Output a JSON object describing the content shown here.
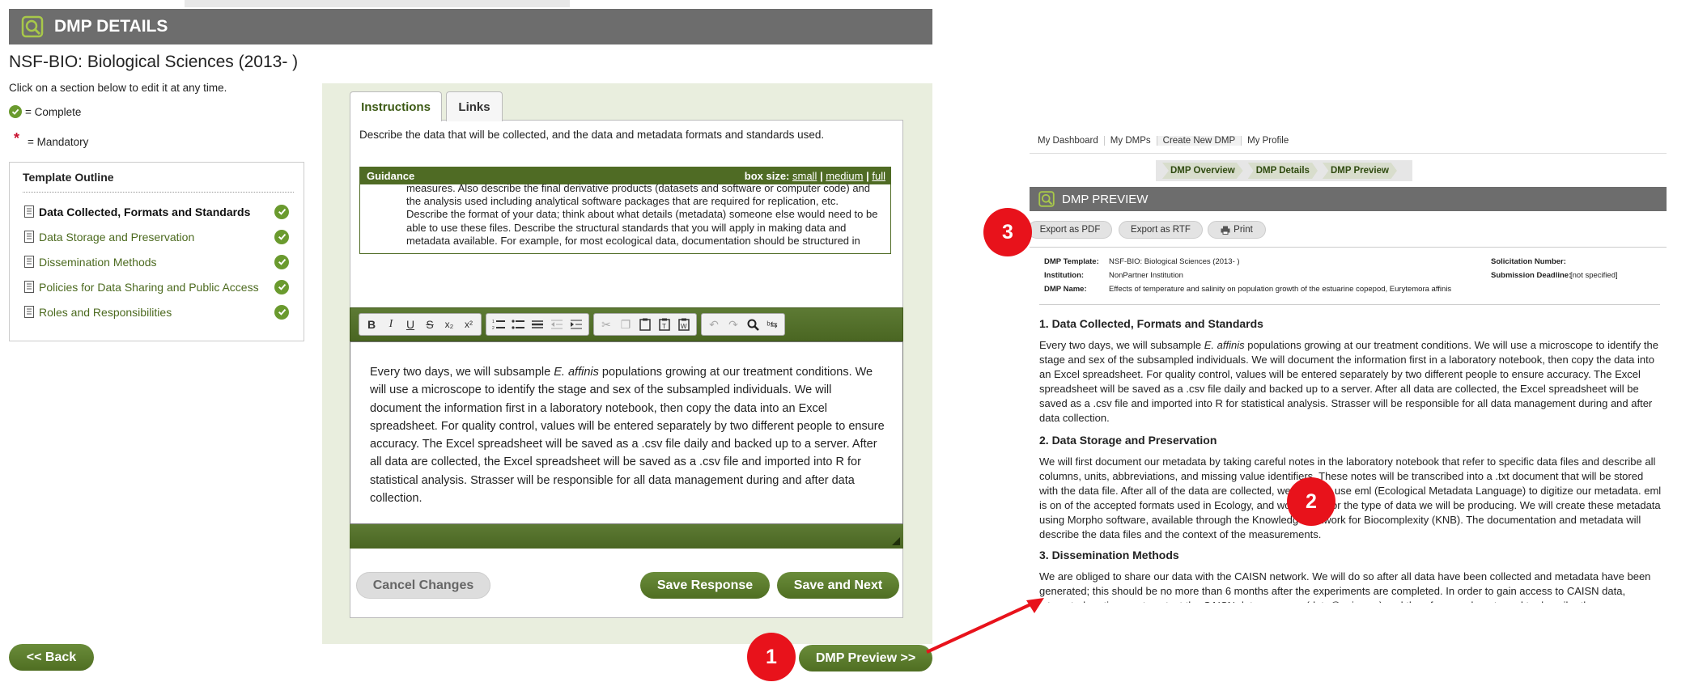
{
  "header": {
    "title": "DMP DETAILS"
  },
  "page": {
    "subtitle": "NSF-BIO: Biological Sciences (2013- )",
    "hint": "Click on a section below to edit it at any time.",
    "legend_complete": "= Complete",
    "legend_mandatory": "= Mandatory",
    "mandatory_mark": "*"
  },
  "outline": {
    "title": "Template Outline",
    "items": [
      {
        "label": "Data Collected, Formats and Standards"
      },
      {
        "label": "Data Storage and Preservation"
      },
      {
        "label": "Dissemination Methods"
      },
      {
        "label": "Policies for Data Sharing and Public Access"
      },
      {
        "label": "Roles and Responsibilities"
      }
    ]
  },
  "tabs": {
    "instructions": "Instructions",
    "links": "Links"
  },
  "instruction_text": "Describe the data that will be collected, and the data and metadata formats and standards used.",
  "guidance": {
    "title": "Guidance",
    "box_size_label": "box size:",
    "small": "small",
    "medium": "medium",
    "full": "full",
    "sep": "|",
    "text": "measures. Also describe the final derivative products (datasets and software or computer code) and the analysis used including analytical software packages that are required for replication, etc. Describe the format of your data; think about what details (metadata) someone else would need to be able to use these files. Describe the structural standards that you will apply in making data and metadata available. For example, for most ecological data, documentation should be structured in"
  },
  "toolbar": {
    "bold": "B",
    "italic": "I",
    "underline": "U",
    "strike": "S",
    "sub": "x₂",
    "sup": "x²",
    "icons": [
      "bold-icon",
      "italic-icon",
      "underline-icon",
      "strikethrough-icon",
      "subscript-icon",
      "superscript-icon",
      "numbered-list-icon",
      "bullet-list-icon",
      "horizontal-rule-icon",
      "outdent-icon",
      "indent-icon",
      "cut-icon",
      "copy-icon",
      "paste-icon",
      "paste-text-icon",
      "paste-word-icon",
      "undo-icon",
      "redo-icon",
      "find-icon",
      "replace-icon"
    ]
  },
  "editor": {
    "pre": "Every two days, we will subsample ",
    "em": "E. affinis",
    "post": " populations growing at our treatment conditions.  We will use a microscope to identify the stage and sex of the subsampled individuals.  We will document the information first in a laboratory notebook, then copy the data into an Excel spreadsheet. For quality control, values will be entered separately by two different people to ensure accuracy.  The Excel spreadsheet will be saved as a .csv file daily and backed up to a server. After all data are collected, the Excel spreadsheet will be saved as a .csv file and imported into R for statistical analysis. Strasser will be responsible for all data management during and after data collection."
  },
  "buttons": {
    "cancel": "Cancel Changes",
    "save": "Save Response",
    "save_next": "Save and Next",
    "back": "<< Back",
    "preview": "DMP Preview >>"
  },
  "callouts": {
    "one": "1",
    "two": "2",
    "three": "3"
  },
  "preview": {
    "nav": [
      "My Dashboard",
      "My DMPs",
      "Create New DMP",
      "My Profile"
    ],
    "crumbs": [
      "DMP Overview",
      "DMP Details",
      "DMP Preview"
    ],
    "title": "DMP PREVIEW",
    "export_pdf": "Export as PDF",
    "export_rtf": "Export as RTF",
    "print": "Print",
    "meta": {
      "template_label": "DMP Template:",
      "template": "NSF-BIO: Biological Sciences (2013- )",
      "institution_label": "Institution:",
      "institution": "NonPartner Institution",
      "name_label": "DMP Name:",
      "name": "Effects of temperature and salinity on population growth of the estuarine copepod, Eurytemora affinis",
      "solicitation_label": "Solicitation Number:",
      "solicitation": "",
      "deadline_label": "Submission Deadline:",
      "deadline": "[not specified]"
    },
    "sections": [
      {
        "title": "1. Data Collected, Formats and Standards",
        "pre": "Every two days, we will subsample ",
        "em": "E. affinis",
        "post": " populations growing at our treatment conditions.  We will use a microscope to identify the stage and sex of the subsampled individuals.  We will document the information first in a laboratory notebook, then copy the data into an Excel spreadsheet. For quality control, values will be entered separately by two different people to ensure accuracy.  The Excel spreadsheet will be saved as a .csv file daily and backed up to a server. After all data are collected, the Excel spreadsheet will be saved as a .csv file and imported into R for statistical analysis. Strasser will be responsible for all data management during and after data collection."
      },
      {
        "title": "2. Data Storage and Preservation",
        "text": "We will first document our metadata by taking careful notes in the laboratory notebook that refer to specific data files and describe all columns, units, abbreviations, and missing value identifiers.  These notes will be transcribed into a .txt document that will be stored with the data file.  After all of the data are collected, we will then use eml (Ecological Metadata Language) to digitize our metadata. eml is on of the accepted formats used in Ecology, and works well for the type of data we will be producing. We will create these metadata using Morpho software, available through the Knowledge Network for Biocomplexity (KNB). The documentation and metadata will describe the data files and the context of the measurements."
      },
      {
        "title": "3. Dissemination Methods",
        "text": "We are obliged to share our data with the CAISN network. We will do so after all data have been collected and metadata have been generated; this should be no more than 6 months after the experiments are completed.  In order to gain access to CAISN data, interested parties must contact the CAISN data manager (data@caisn.ca) and therefore we do not need to describe the"
      }
    ]
  }
}
